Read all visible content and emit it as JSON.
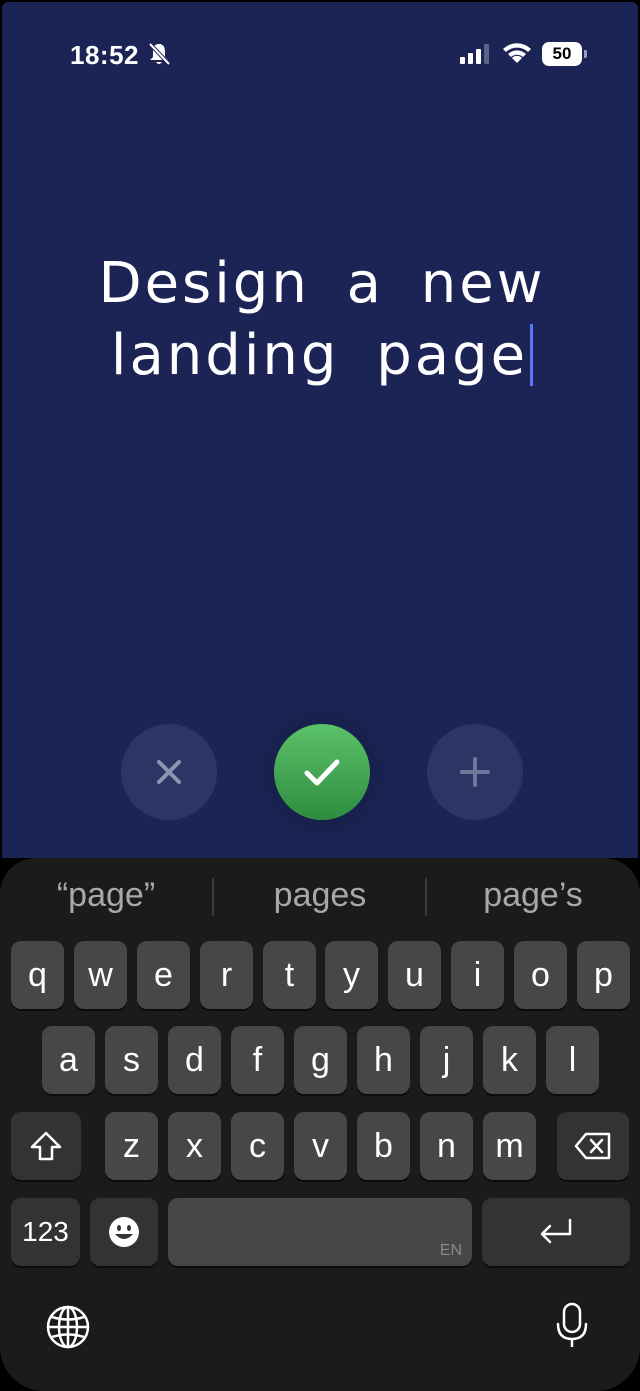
{
  "status_bar": {
    "time": "18:52",
    "battery_level": "50"
  },
  "task": {
    "text": "Design a new landing page"
  },
  "actions": {
    "icons": [
      "close-icon",
      "checkmark-icon",
      "plus-icon"
    ],
    "confirm_color": "#4caf50",
    "background_color": "#1b2454"
  },
  "keyboard": {
    "suggestions": [
      "“page”",
      "pages",
      "page’s"
    ],
    "row1": [
      "q",
      "w",
      "e",
      "r",
      "t",
      "y",
      "u",
      "i",
      "o",
      "p"
    ],
    "row2": [
      "a",
      "s",
      "d",
      "f",
      "g",
      "h",
      "j",
      "k",
      "l"
    ],
    "row3": [
      "z",
      "x",
      "c",
      "v",
      "b",
      "n",
      "m"
    ],
    "numbers_key": "123",
    "language_label": "EN"
  }
}
